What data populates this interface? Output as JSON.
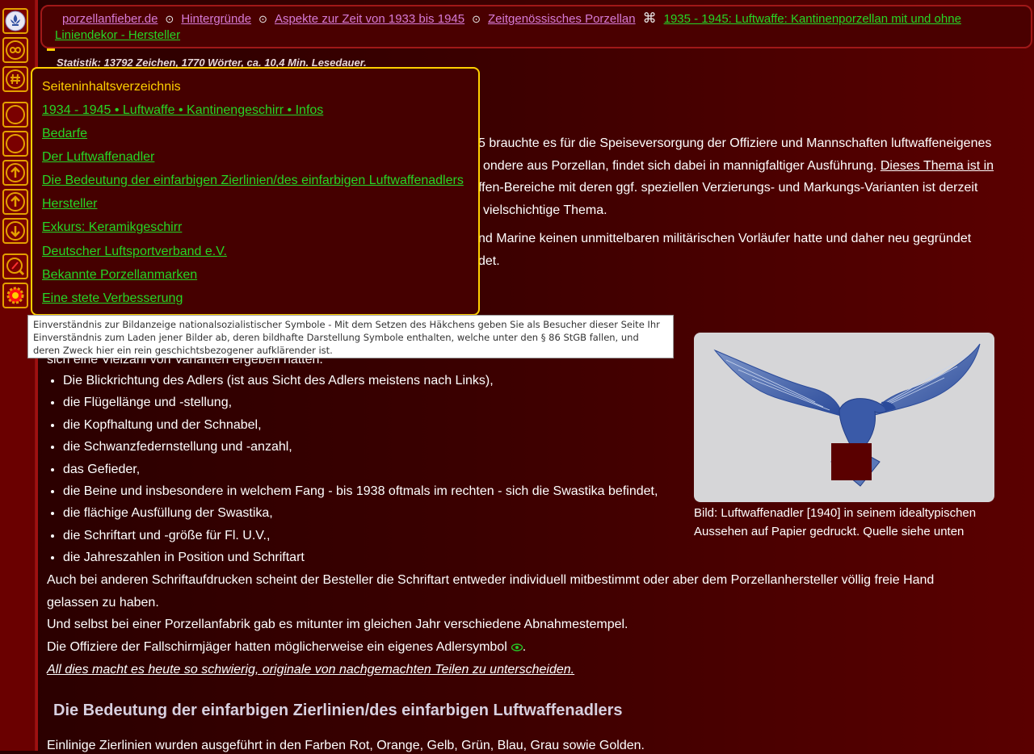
{
  "sidebar": {
    "buttons": [
      {
        "icon": "fleur-de-lis-icon"
      },
      {
        "icon": "infinity-icon"
      },
      {
        "icon": "hashtag-icon"
      },
      {
        "icon": "circle-icon"
      },
      {
        "icon": "circle-icon"
      },
      {
        "icon": "arrow-up-icon"
      },
      {
        "icon": "arrow-up-icon"
      },
      {
        "icon": "arrow-down-icon"
      },
      {
        "icon": "search-icon"
      },
      {
        "icon": "settings-gear-icon"
      }
    ]
  },
  "breadcrumb": {
    "items": [
      "porzellanfieber.de",
      "Hintergründe",
      "Aspekte zur Zeit von 1933 bis 1945",
      "Zeitgenössisches Porzellan"
    ],
    "separator": "⊙",
    "current_separator": "⌘",
    "current_line1": "1935 - 1945: Luftwaffe: Kantinenporzellan mit und ohne",
    "current_line2": "Liniendekor - Hersteller"
  },
  "stats": "Statistik: 13792 Zeichen, 1770 Wörter, ca. 10,4 Min. Lesedauer.",
  "toc": {
    "title": "Seiteninhaltsverzeichnis",
    "items": [
      "1934 - 1945 • Luftwaffe • Kantinengeschirr • Infos",
      "Bedarfe",
      "Der Luftwaffenadler",
      "Die Bedeutung der einfarbigen Zierlinien/des einfarbigen Luftwaffenadlers",
      "Hersteller",
      "Exkurs: Keramikgeschirr",
      "Deutscher Luftsportverband e.V.",
      "Bekannte Porzellanmarken",
      "Eine stete Verbesserung"
    ]
  },
  "tooltip": {
    "text": "Einverständnis zur Bildanzeige nationalsozialistischer Symbole - Mit dem Setzen des Häkchens geben Sie als Besucher dieser Seite Ihr Einverständnis zum Laden jener Bilder ab, deren bildhafte Darstellung Symbole enthalten, welche unter den § 86 StGB fallen, und deren Zweck hier ein rein geschichtsbezogener aufklärender ist."
  },
  "intro": {
    "line1": "5 brauchte es für die Speiseversorgung der Offiziere und Mannschaften luftwaffeneigenes",
    "line2_text": "ondere aus Porzellan, findet sich dabei in mannigfaltiger Ausführung. ",
    "line2_link": "Dieses Thema ist in",
    "line3": "ffen-Bereiche mit deren ggf. speziellen Verzierungs- und Markungs-Varianten ist derzeit",
    "line4": "vielschichtige Thema.",
    "line5": "nd Marine keinen unmittelbaren militärischen Vorläufer hatte und daher neu gegründet",
    "line6": "det."
  },
  "variants_intro": "sich eine Vielzahl von Varianten ergeben hatten:",
  "features": [
    "Die Blickrichtung des Adlers (ist aus Sicht des Adlers meistens nach Links),",
    "die Flügellänge und -stellung,",
    "die Kopfhaltung und der Schnabel,",
    "die Schwanzfedernstellung und -anzahl,",
    "das Gefieder,",
    "die Beine und insbesondere in welchem Fang - bis 1938 oftmals im rechten - sich die Swastika befindet,",
    "die flächige Ausfüllung der Swastika,",
    "die Schriftart und -größe für Fl. U.V.,",
    "die Jahreszahlen in Position und Schriftart"
  ],
  "paragraphs": {
    "p1_line1": "Auch bei anderen Schriftaufdrucken scheint der Besteller die Schriftart entweder individuell mitbestimmt oder aber dem Porzellanhersteller völlig freie Hand",
    "p1_line2": "gelassen zu haben.",
    "p2": "Und selbst bei einer Porzellanfabrik gab es mitunter im gleichen Jahr verschiedene Abnahmestempel.",
    "p3": "Die Offiziere der Fallschirmjäger hatten möglicherweise ein eigenes Adlersymbol",
    "p3_end": ".",
    "p4": "All dies macht es heute so schwierig, originale von nachgemachten Teilen zu unterscheiden."
  },
  "figure": {
    "caption_line1": "Bild: Luftwaffenadler [1940] in seinem idealtypischen",
    "caption_line2": "Aussehen auf Papier gedruckt. Quelle siehe unten"
  },
  "section_heading": "Die Bedeutung der einfarbigen Zierlinien/des einfarbigen Luftwaffenadlers",
  "section_text": "Einlinige Zierlinien wurden ausgeführt in den Farben Rot, Orange, Gelb, Grün, Blau, Grau sowie Golden.",
  "colors": {
    "background": "#3a0000",
    "accent": "#ffd000",
    "link_green": "#26d626",
    "link_pink": "#d67ad6",
    "sidebar_border": "#e4a000"
  }
}
